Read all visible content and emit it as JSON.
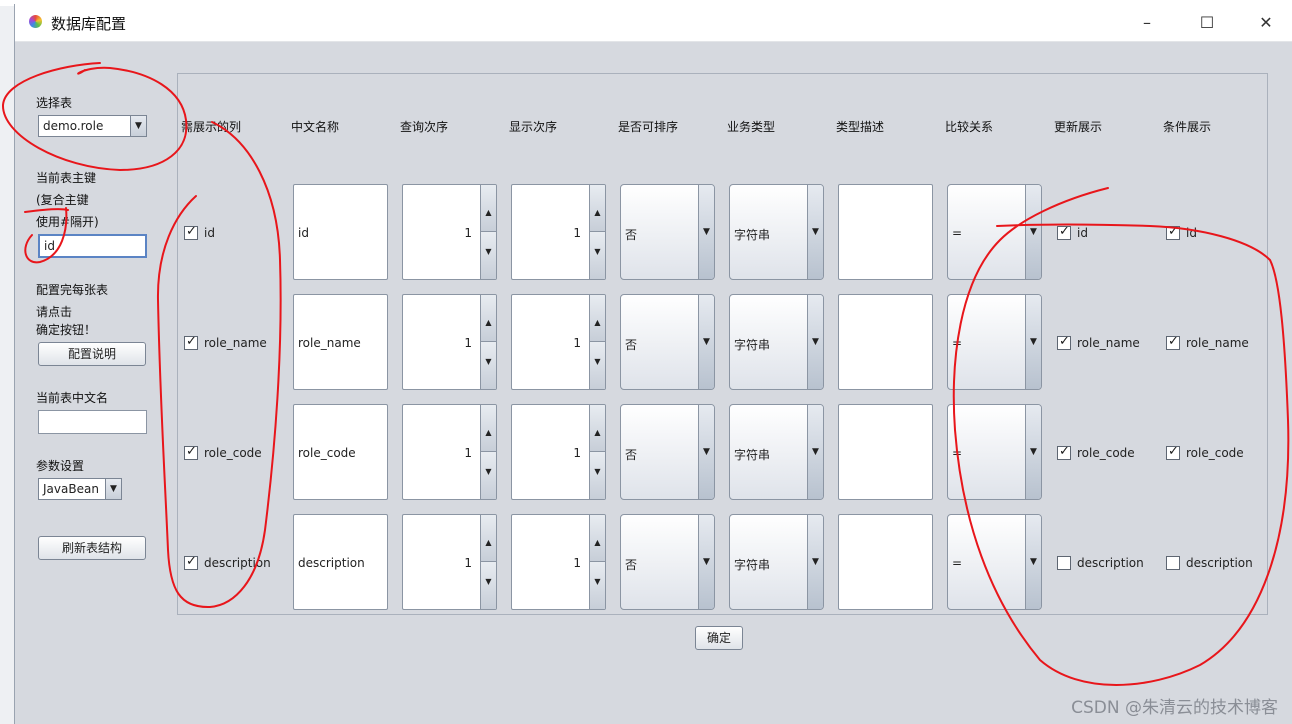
{
  "window": {
    "title": "数据库配置",
    "minimize": "–",
    "maximize": "☐",
    "close": "✕",
    "icon": "color-wheel-icon"
  },
  "left": {
    "select_table_label": "选择表",
    "table_combo_value": "demo.role",
    "pk_label_1": "当前表主键",
    "pk_label_2": "(复合主键",
    "pk_label_3": "使用#隔开)",
    "pk_value": "id",
    "tip_1": "配置完每张表",
    "tip_2": "请点击",
    "tip_3": "确定按钮！",
    "config_help_button": "配置说明",
    "cn_name_label": "当前表中文名",
    "cn_name_value": "",
    "param_label": "参数设置",
    "param_combo_value": "JavaBean",
    "refresh_button": "刷新表结构"
  },
  "table": {
    "headers": [
      "需展示的列",
      "中文名称",
      "查询次序",
      "显示次序",
      "是否可排序",
      "业务类型",
      "类型描述",
      "比较关系",
      "更新展示",
      "条件展示"
    ],
    "rows": [
      {
        "column": "id",
        "show": true,
        "cn_name": "id",
        "query_order": "1",
        "display_order": "1",
        "sortable": "否",
        "biz_type": "字符串",
        "type_desc": "",
        "compare": "=",
        "update_show": true,
        "update_label": "id",
        "cond_show": true,
        "cond_label": "id"
      },
      {
        "column": "role_name",
        "show": true,
        "cn_name": "role_name",
        "query_order": "1",
        "display_order": "1",
        "sortable": "否",
        "biz_type": "字符串",
        "type_desc": "",
        "compare": "=",
        "update_show": true,
        "update_label": "role_name",
        "cond_show": true,
        "cond_label": "role_name"
      },
      {
        "column": "role_code",
        "show": true,
        "cn_name": "role_code",
        "query_order": "1",
        "display_order": "1",
        "sortable": "否",
        "biz_type": "字符串",
        "type_desc": "",
        "compare": "=",
        "update_show": true,
        "update_label": "role_code",
        "cond_show": true,
        "cond_label": "role_code"
      },
      {
        "column": "description",
        "show": true,
        "cn_name": "description",
        "query_order": "1",
        "display_order": "1",
        "sortable": "否",
        "biz_type": "字符串",
        "type_desc": "",
        "compare": "=",
        "update_show": false,
        "update_label": "description",
        "cond_show": false,
        "cond_label": "description"
      }
    ]
  },
  "confirm_button": "确定",
  "watermark": "CSDN @朱清云的技术博客",
  "glyphs": {
    "check": "✓",
    "down": "▼",
    "up": "▲"
  },
  "colors": {
    "annotation": "#e8161b",
    "window_bg": "#d6d9df"
  }
}
